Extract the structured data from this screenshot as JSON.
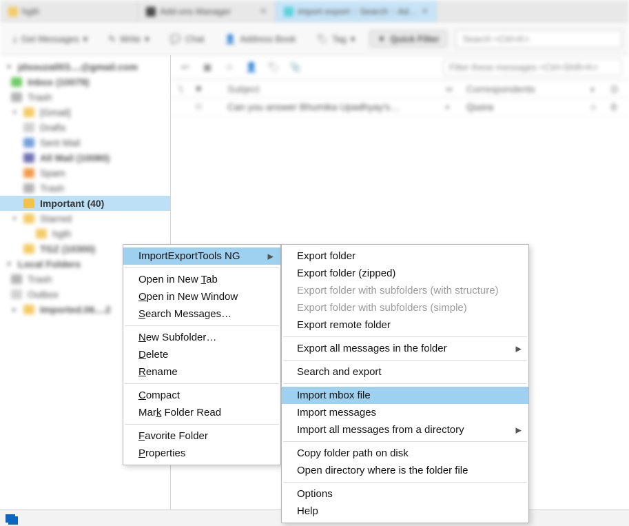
{
  "tabs": [
    {
      "label": "hgth",
      "active": false
    },
    {
      "label": "Add-ons Manager",
      "active": false
    },
    {
      "label": "import export :: Search :: Ad…",
      "active": true
    }
  ],
  "toolbar": {
    "get_messages": "Get Messages",
    "write": "Write",
    "chat": "Chat",
    "address_book": "Address Book",
    "tag": "Tag",
    "quick_filter": "Quick Filter",
    "search_placeholder": "Search <Ctrl+K>"
  },
  "folders": {
    "account": "jdsouza003....@gmail.com",
    "inbox": "Inbox (10079)",
    "trash": "Trash",
    "gmail": "[Gmail]",
    "drafts": "Drafts",
    "sent": "Sent Mail",
    "all": "All Mail (10080)",
    "spam": "Spam",
    "gtrash": "Trash",
    "important": "Important (40)",
    "starred": "Starred",
    "hgth": "hgth",
    "tgz": "TGZ (10300)",
    "local": "Local Folders",
    "ltrash": "Trash",
    "outbox": "Outbox",
    "imported": "Imported.06....2"
  },
  "messages": {
    "search_placeholder": "Filter these messages <Ctrl+Shift+K>",
    "columns": {
      "subject": "Subject",
      "correspondents": "Correspondents",
      "date_short": "D"
    },
    "rows": [
      {
        "subject": "Can you answer Bhumika Upadhyay's…",
        "corr": "Quora",
        "flag": "0"
      }
    ]
  },
  "menu": {
    "main": {
      "import_export": "ImportExportTools NG",
      "open_tab": "Open in New Tab",
      "open_win": "Open in New Window",
      "search": "Search Messages…",
      "new_sub": "New Subfolder…",
      "delete": "Delete",
      "rename": "Rename",
      "compact": "Compact",
      "mark_read": "Mark Folder Read",
      "favorite": "Favorite Folder",
      "properties": "Properties"
    },
    "sub": {
      "export_folder": "Export folder",
      "export_zip": "Export folder (zipped)",
      "export_sub_struct": "Export folder with subfolders (with structure)",
      "export_sub_simple": "Export folder with subfolders (simple)",
      "export_remote": "Export remote folder",
      "export_all": "Export all messages in the folder",
      "search_export": "Search and export",
      "import_mbox": "Import mbox file",
      "import_msgs": "Import messages",
      "import_dir": "Import all messages from a directory",
      "copy_path": "Copy folder path on disk",
      "open_dir": "Open directory where is the folder file",
      "options": "Options",
      "help": "Help"
    }
  }
}
